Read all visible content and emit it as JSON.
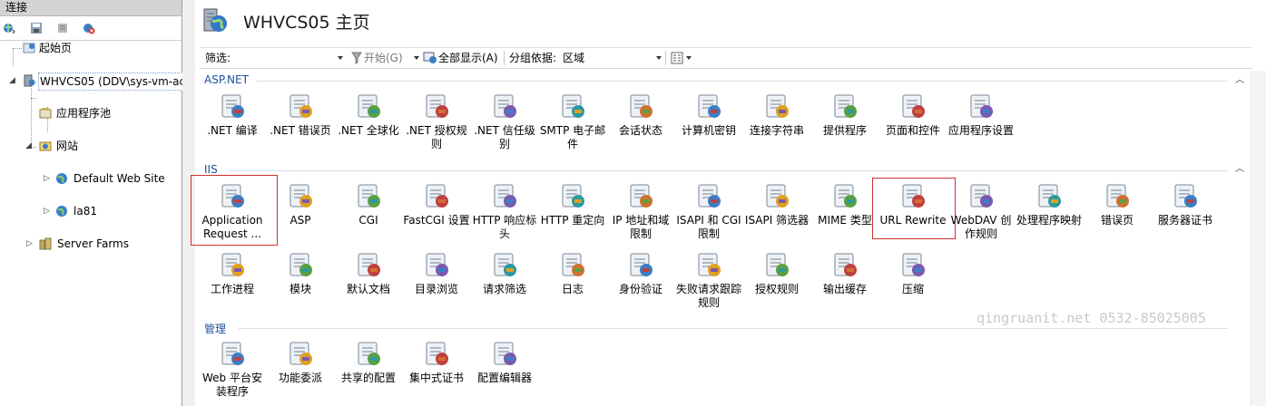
{
  "connections": {
    "header": "连接",
    "toolbar_icons": [
      "globe-connect-icon",
      "save-icon",
      "server-icon",
      "disconnect-icon"
    ],
    "tree": [
      {
        "label": "起始页",
        "icon": "start-page-icon",
        "level": 0
      },
      {
        "label": "WHVCS05 (DDV\\sys-vm-ac",
        "icon": "server-icon",
        "level": 0,
        "selected": true
      },
      {
        "label": "应用程序池",
        "icon": "app-pool-icon",
        "level": 1
      },
      {
        "label": "网站",
        "icon": "sites-icon",
        "level": 1
      },
      {
        "label": "Default Web Site",
        "icon": "globe-icon",
        "level": 2
      },
      {
        "label": "la81",
        "icon": "globe-icon",
        "level": 2
      },
      {
        "label": "Server Farms",
        "icon": "server-farm-icon",
        "level": 1
      }
    ]
  },
  "main": {
    "title": "WHVCS05 主页",
    "filter": {
      "label": "筛选:",
      "start": "开始(G)",
      "show_all": "全部显示(A)",
      "group_by_label": "分组依据:",
      "group_by_value": "区域"
    },
    "groups": {
      "aspnet": {
        "title": "ASP.NET",
        "items": [
          {
            "label": ".NET 编译",
            "icon": "net-compile-icon"
          },
          {
            "label": ".NET 错误页",
            "icon": "net-error-page-icon"
          },
          {
            "label": ".NET 全球化",
            "icon": "net-globalization-icon"
          },
          {
            "label": ".NET 授权规则",
            "icon": "net-authorization-icon"
          },
          {
            "label": ".NET 信任级别",
            "icon": "net-trust-icon"
          },
          {
            "label": "SMTP 电子邮件",
            "icon": "smtp-email-icon"
          },
          {
            "label": "会话状态",
            "icon": "session-state-icon"
          },
          {
            "label": "计算机密钥",
            "icon": "machine-key-icon"
          },
          {
            "label": "连接字符串",
            "icon": "connection-string-icon"
          },
          {
            "label": "提供程序",
            "icon": "providers-icon"
          },
          {
            "label": "页面和控件",
            "icon": "pages-controls-icon"
          },
          {
            "label": "应用程序设置",
            "icon": "app-settings-icon"
          }
        ]
      },
      "iis": {
        "title": "IIS",
        "items": [
          {
            "label": "Application Request ...",
            "icon": "arr-icon"
          },
          {
            "label": "ASP",
            "icon": "asp-icon"
          },
          {
            "label": "CGI",
            "icon": "cgi-icon"
          },
          {
            "label": "FastCGI 设置",
            "icon": "fastcgi-icon"
          },
          {
            "label": "HTTP 响应标头",
            "icon": "http-headers-icon"
          },
          {
            "label": "HTTP 重定向",
            "icon": "http-redirect-icon"
          },
          {
            "label": "IP 地址和域限制",
            "icon": "ip-restrictions-icon"
          },
          {
            "label": "ISAPI 和 CGI 限制",
            "icon": "isapi-cgi-icon"
          },
          {
            "label": "ISAPI 筛选器",
            "icon": "isapi-filter-icon"
          },
          {
            "label": "MIME 类型",
            "icon": "mime-types-icon"
          },
          {
            "label": "URL Rewrite",
            "icon": "url-rewrite-icon"
          },
          {
            "label": "WebDAV 创作规则",
            "icon": "webdav-icon"
          },
          {
            "label": "处理程序映射",
            "icon": "handler-mappings-icon"
          },
          {
            "label": "错误页",
            "icon": "error-pages-icon"
          },
          {
            "label": "服务器证书",
            "icon": "server-certificates-icon"
          },
          {
            "label": "工作进程",
            "icon": "worker-process-icon"
          },
          {
            "label": "模块",
            "icon": "modules-icon"
          },
          {
            "label": "默认文档",
            "icon": "default-document-icon"
          },
          {
            "label": "目录浏览",
            "icon": "directory-browsing-icon"
          },
          {
            "label": "请求筛选",
            "icon": "request-filtering-icon"
          },
          {
            "label": "日志",
            "icon": "logging-icon"
          },
          {
            "label": "身份验证",
            "icon": "authentication-icon"
          },
          {
            "label": "失败请求跟踪规则",
            "icon": "failed-request-icon"
          },
          {
            "label": "授权规则",
            "icon": "authorization-rules-icon"
          },
          {
            "label": "输出缓存",
            "icon": "output-cache-icon"
          },
          {
            "label": "压缩",
            "icon": "compression-icon"
          }
        ]
      },
      "management": {
        "title": "管理",
        "items": [
          {
            "label": "Web 平台安装程序",
            "icon": "web-platform-installer-icon"
          },
          {
            "label": "功能委派",
            "icon": "feature-delegation-icon"
          },
          {
            "label": "共享的配置",
            "icon": "shared-config-icon"
          },
          {
            "label": "集中式证书",
            "icon": "central-cert-icon"
          },
          {
            "label": "配置编辑器",
            "icon": "config-editor-icon"
          }
        ]
      }
    }
  },
  "watermark": "qingruanit.net 0532-85025005",
  "colors": {
    "group_header": "#1e4f9c",
    "highlight": "#d03030",
    "watermark": "#c9c9c9"
  }
}
